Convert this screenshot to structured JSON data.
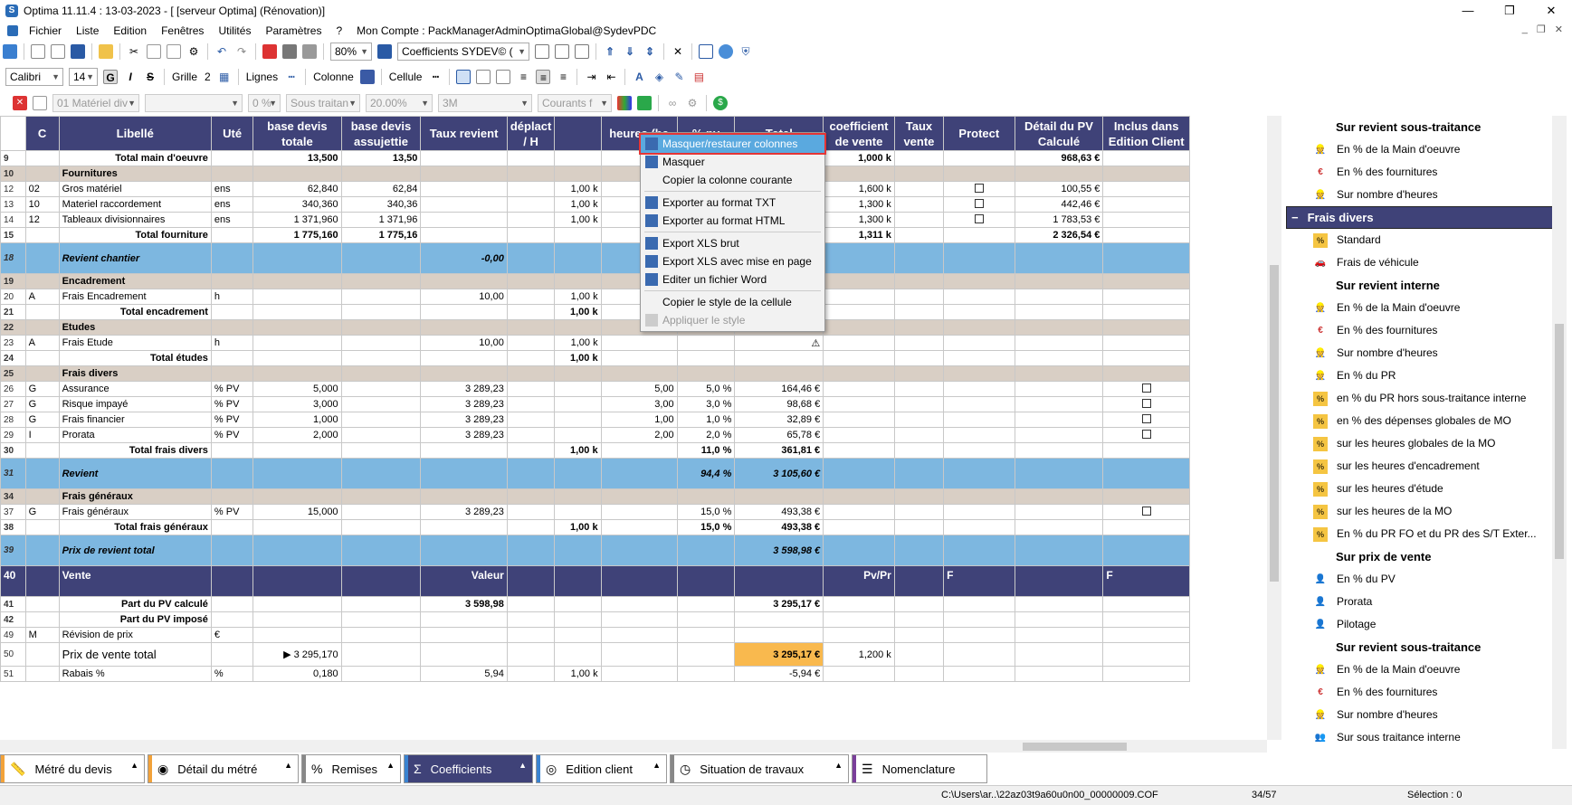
{
  "window": {
    "title": "Optima 11.11.4 : 13-03-2023 - [ [serveur Optima] (Rénovation)]",
    "min": "—",
    "max": "❐",
    "close": "✕"
  },
  "menu": [
    "Fichier",
    "Liste",
    "Edition",
    "Fenêtres",
    "Utilités",
    "Paramètres",
    "?",
    "Mon Compte : PackManagerAdminOptimaGlobal@SydevPDC"
  ],
  "toolbar1": {
    "zoom": "80%",
    "profile": "Coefficients  SYDEV© ("
  },
  "toolbar2": {
    "font": "Calibri",
    "size": "14",
    "bold": "G",
    "italic": "I",
    "strike": "S",
    "grille_label": "Grille",
    "grille_val": "2",
    "lignes_label": "Lignes",
    "colonne_label": "Colonne",
    "cellule_label": "Cellule"
  },
  "toolbar3": {
    "c1": "01  Matériel div",
    "c3": "0 %",
    "c4": "Sous traitan",
    "c5": "20.00%",
    "c6": "3M",
    "c7": "Courants f"
  },
  "grid": {
    "headers": [
      "",
      "C",
      "Libellé",
      "Uté",
      "base devis totale",
      "base devis assujettie",
      "Taux revient",
      "déplact / H",
      "",
      "heures (ba",
      "% pv",
      "Total",
      "coefficient de vente",
      "Taux vente",
      "Protect",
      "Détail du PV Calculé",
      "Inclus dans Edition Client"
    ],
    "rows": [
      {
        "kind": "tot",
        "cells": [
          "9",
          "",
          "Total main d'oeuvre",
          "",
          "13,500",
          "13,50",
          "",
          "",
          "",
          "",
          "",
          "€",
          "1,000 k",
          "",
          "",
          "968,63 €",
          ""
        ]
      },
      {
        "kind": "sect",
        "cells": [
          "10",
          "",
          "Fournitures",
          "",
          "",
          "",
          "",
          "",
          "",
          "",
          "",
          "",
          "",
          "",
          "",
          "",
          ""
        ]
      },
      {
        "kind": "row",
        "cells": [
          "12",
          "02",
          "Gros matériel",
          "ens",
          "62,840",
          "62,84",
          "",
          "",
          "1,00 k",
          "",
          "",
          "€",
          "1,600 k",
          "",
          "chk",
          "100,55 €",
          ""
        ]
      },
      {
        "kind": "row",
        "cells": [
          "13",
          "10",
          "Materiel raccordement",
          "ens",
          "340,360",
          "340,36",
          "",
          "",
          "1,00 k",
          "",
          "",
          "€",
          "1,300 k",
          "",
          "chk",
          "442,46 €",
          ""
        ]
      },
      {
        "kind": "row",
        "cells": [
          "14",
          "12",
          "Tableaux divisionnaires",
          "ens",
          "1 371,960",
          "1 371,96",
          "",
          "",
          "1,00 k",
          "",
          "",
          "€",
          "1,300 k",
          "",
          "chk",
          "1 783,53 €",
          ""
        ]
      },
      {
        "kind": "tot",
        "cells": [
          "15",
          "",
          "Total fourniture",
          "",
          "1 775,160",
          "1 775,16",
          "",
          "",
          "",
          "",
          "",
          "€",
          "1,311 k",
          "",
          "",
          "2 326,54 €",
          ""
        ]
      },
      {
        "kind": "blue",
        "cells": [
          "18",
          "",
          "Revient chantier",
          "",
          "",
          "",
          "-0,00",
          "",
          "",
          "",
          "",
          "€",
          "",
          "",
          "",
          "",
          ""
        ]
      },
      {
        "kind": "sect",
        "cells": [
          "19",
          "",
          "Encadrement",
          "",
          "",
          "",
          "",
          "",
          "",
          "",
          "",
          "",
          "",
          "",
          "",
          "",
          ""
        ]
      },
      {
        "kind": "row",
        "cells": [
          "20",
          "A",
          "Frais Encadrement",
          "h",
          "",
          "",
          "10,00",
          "",
          "1,00 k",
          "",
          "",
          "",
          "",
          "",
          "",
          "",
          ""
        ]
      },
      {
        "kind": "tot",
        "cells": [
          "21",
          "",
          "Total encadrement",
          "",
          "",
          "",
          "",
          "",
          "1,00 k",
          "",
          "",
          "",
          "",
          "",
          "",
          "",
          ""
        ]
      },
      {
        "kind": "sect",
        "cells": [
          "22",
          "",
          "Etudes",
          "",
          "",
          "",
          "",
          "",
          "",
          "",
          "",
          "",
          "",
          "",
          "",
          "",
          ""
        ]
      },
      {
        "kind": "row",
        "cells": [
          "23",
          "A",
          "Frais Etude",
          "h",
          "",
          "",
          "10,00",
          "",
          "1,00 k",
          "",
          "",
          "⚠",
          "",
          "",
          "",
          "",
          ""
        ]
      },
      {
        "kind": "tot",
        "cells": [
          "24",
          "",
          "Total études",
          "",
          "",
          "",
          "",
          "",
          "1,00 k",
          "",
          "",
          "",
          "",
          "",
          "",
          "",
          ""
        ]
      },
      {
        "kind": "sect",
        "cells": [
          "25",
          "",
          "Frais divers",
          "",
          "",
          "",
          "",
          "",
          "",
          "",
          "",
          "",
          "",
          "",
          "",
          "",
          ""
        ]
      },
      {
        "kind": "row",
        "cells": [
          "26",
          "G",
          "Assurance",
          "% PV",
          "5,000",
          "",
          "3 289,23",
          "",
          "",
          "5,00",
          "5,0 %",
          "164,46 €",
          "",
          "",
          "",
          "",
          "chk"
        ]
      },
      {
        "kind": "row",
        "cells": [
          "27",
          "G",
          "Risque impayé",
          "% PV",
          "3,000",
          "",
          "3 289,23",
          "",
          "",
          "3,00",
          "3,0 %",
          "98,68 €",
          "",
          "",
          "",
          "",
          "chk"
        ]
      },
      {
        "kind": "row",
        "cells": [
          "28",
          "G",
          "Frais financier",
          "% PV",
          "1,000",
          "",
          "3 289,23",
          "",
          "",
          "1,00",
          "1,0 %",
          "32,89 €",
          "",
          "",
          "",
          "",
          "chk"
        ]
      },
      {
        "kind": "row",
        "cells": [
          "29",
          "I",
          "Prorata",
          "% PV",
          "2,000",
          "",
          "3 289,23",
          "",
          "",
          "2,00",
          "2,0 %",
          "65,78 €",
          "",
          "",
          "",
          "",
          "chk"
        ]
      },
      {
        "kind": "tot",
        "cells": [
          "30",
          "",
          "Total frais divers",
          "",
          "",
          "",
          "",
          "",
          "1,00 k",
          "",
          "11,0 %",
          "361,81 €",
          "",
          "",
          "",
          "",
          ""
        ]
      },
      {
        "kind": "blue",
        "cells": [
          "31",
          "",
          "Revient",
          "",
          "",
          "",
          "",
          "",
          "",
          "",
          "94,4 %",
          "3 105,60 €",
          "",
          "",
          "",
          "",
          ""
        ]
      },
      {
        "kind": "sect",
        "cells": [
          "34",
          "",
          "Frais généraux",
          "",
          "",
          "",
          "",
          "",
          "",
          "",
          "",
          "",
          "",
          "",
          "",
          "",
          ""
        ]
      },
      {
        "kind": "row",
        "cells": [
          "37",
          "G",
          "Frais généraux",
          "% PV",
          "15,000",
          "",
          "3 289,23",
          "",
          "",
          "",
          "15,0 %",
          "493,38 €",
          "",
          "",
          "",
          "",
          "chk"
        ]
      },
      {
        "kind": "tot",
        "cells": [
          "38",
          "",
          "Total frais généraux",
          "",
          "",
          "",
          "",
          "",
          "1,00 k",
          "",
          "15,0 %",
          "493,38 €",
          "",
          "",
          "",
          "",
          ""
        ]
      },
      {
        "kind": "blue",
        "cells": [
          "39",
          "",
          "Prix de revient total",
          "",
          "",
          "",
          "",
          "",
          "",
          "",
          "",
          "3 598,98 €",
          "",
          "",
          "",
          "",
          ""
        ]
      },
      {
        "kind": "vente",
        "cells": [
          "40",
          "",
          "Vente",
          "",
          "",
          "",
          "Valeur",
          "",
          "",
          "",
          "",
          "",
          "Pv/Pr",
          "",
          "F",
          "",
          "F"
        ]
      },
      {
        "kind": "tot",
        "cells": [
          "41",
          "",
          "Part du PV calculé",
          "",
          "",
          "",
          "3 598,98",
          "",
          "",
          "",
          "",
          "3 295,17 €",
          "",
          "",
          "",
          "",
          ""
        ]
      },
      {
        "kind": "tot",
        "cells": [
          "42",
          "",
          "Part du PV imposé",
          "",
          "",
          "",
          "",
          "",
          "",
          "",
          "",
          "",
          "",
          "",
          "",
          "",
          ""
        ]
      },
      {
        "kind": "row",
        "cells": [
          "49",
          "M",
          "Révision de prix",
          "€",
          "",
          "",
          "",
          "",
          "",
          "",
          "",
          "",
          "",
          "",
          "",
          "",
          ""
        ]
      },
      {
        "kind": "tall",
        "cells": [
          "50",
          "",
          "Prix de vente total",
          "",
          "▶  3 295,170",
          "",
          "",
          "",
          "",
          "",
          "",
          "3 295,17 €",
          "1,200 k",
          "",
          "",
          "",
          ""
        ]
      },
      {
        "kind": "row",
        "cells": [
          "51",
          "",
          "Rabais %",
          "%",
          "0,180",
          "",
          "5,94",
          "",
          "1,00 k",
          "",
          "",
          "-5,94 €",
          "",
          "",
          "",
          "",
          ""
        ]
      }
    ]
  },
  "context_menu": [
    {
      "label": "Masquer/restaurer colonnes",
      "state": "highlighted",
      "icon": "columns-icon"
    },
    {
      "label": "Masquer",
      "state": "normal",
      "icon": "hide-icon"
    },
    {
      "label": "Copier la colonne courante",
      "state": "normal",
      "icon": ""
    },
    {
      "sep": true
    },
    {
      "label": "Exporter au format TXT",
      "state": "normal",
      "icon": "txt-icon"
    },
    {
      "label": "Exporter au format HTML",
      "state": "normal",
      "icon": "html-icon"
    },
    {
      "sep": true
    },
    {
      "label": "Export XLS brut",
      "state": "normal",
      "icon": "xls-icon"
    },
    {
      "label": "Export XLS avec mise en page",
      "state": "normal",
      "icon": "xls-layout-icon"
    },
    {
      "label": "Editer un fichier Word",
      "state": "normal",
      "icon": "word-icon"
    },
    {
      "sep": true
    },
    {
      "label": "Copier le style de la cellule",
      "state": "normal",
      "icon": ""
    },
    {
      "label": "Appliquer le style",
      "state": "disabled",
      "icon": "apply-style-icon"
    }
  ],
  "right_panel": [
    {
      "type": "hdr",
      "label": "Sur revient sous-traitance"
    },
    {
      "type": "item",
      "label": "En % de la Main d'oeuvre",
      "icon": "worker-icon"
    },
    {
      "type": "item",
      "label": "En % des fournitures",
      "icon": "euro-icon"
    },
    {
      "type": "item",
      "label": "Sur nombre d'heures",
      "icon": "worker-icon"
    },
    {
      "type": "group",
      "label": "Frais divers"
    },
    {
      "type": "item",
      "label": "Standard",
      "icon": "percent-icon"
    },
    {
      "type": "item",
      "label": "Frais de véhicule",
      "icon": "car-icon"
    },
    {
      "type": "hdr",
      "label": "Sur revient interne"
    },
    {
      "type": "item",
      "label": "En % de la Main d'oeuvre",
      "icon": "worker-icon"
    },
    {
      "type": "item",
      "label": "En % des fournitures",
      "icon": "euro-icon"
    },
    {
      "type": "item",
      "label": "Sur nombre d'heures",
      "icon": "worker-icon"
    },
    {
      "type": "item",
      "label": "En % du PR",
      "icon": "worker-icon"
    },
    {
      "type": "item",
      "label": "en % du PR hors sous-traitance interne",
      "icon": "percent-icon"
    },
    {
      "type": "item",
      "label": "en % des dépenses globales de MO",
      "icon": "percent-icon"
    },
    {
      "type": "item",
      "label": "sur les heures globales de la MO",
      "icon": "percent-icon"
    },
    {
      "type": "item",
      "label": "sur les heures d'encadrement",
      "icon": "percent-icon"
    },
    {
      "type": "item",
      "label": "sur les heures d'étude",
      "icon": "percent-icon"
    },
    {
      "type": "item",
      "label": "sur les heures de la MO",
      "icon": "percent-icon"
    },
    {
      "type": "item",
      "label": "En % du PR FO et du PR des S/T Exter...",
      "icon": "percent-icon"
    },
    {
      "type": "hdr",
      "label": "Sur prix de vente"
    },
    {
      "type": "item",
      "label": "En % du PV",
      "icon": "person-icon"
    },
    {
      "type": "item",
      "label": "Prorata",
      "icon": "person-icon"
    },
    {
      "type": "item",
      "label": "Pilotage",
      "icon": "person-icon"
    },
    {
      "type": "hdr",
      "label": "Sur revient sous-traitance"
    },
    {
      "type": "item",
      "label": "En % de la Main d'oeuvre",
      "icon": "worker-icon"
    },
    {
      "type": "item",
      "label": "En % des fournitures",
      "icon": "euro-icon"
    },
    {
      "type": "item",
      "label": "Sur nombre d'heures",
      "icon": "worker-icon"
    },
    {
      "type": "item",
      "label": "Sur sous traitance interne",
      "icon": "group-icon"
    }
  ],
  "tabs": [
    {
      "label": "Métré du devis",
      "icon": "ruler-icon",
      "active": false,
      "stripe": "#f2a23a",
      "width": 160
    },
    {
      "label": "Détail du métré",
      "icon": "eye-icon",
      "active": false,
      "stripe": "#f2a23a",
      "width": 167
    },
    {
      "label": "Remises",
      "icon": "percent-tab-icon",
      "active": false,
      "stripe": "#888888",
      "width": 110
    },
    {
      "label": "Coefficients",
      "icon": "sigma-icon",
      "active": true,
      "stripe": "#3a83d0",
      "width": 143
    },
    {
      "label": "Edition client",
      "icon": "person-tab-icon",
      "active": false,
      "stripe": "#3a83d0",
      "width": 145
    },
    {
      "label": "Situation de travaux",
      "icon": "clock-tab-icon",
      "active": false,
      "stripe": "#888888",
      "width": 198
    },
    {
      "label": "Nomenclature",
      "icon": "list-tab-icon",
      "active": false,
      "stripe": "#7a3f9a",
      "width": 150
    }
  ],
  "status": {
    "path": "C:\\Users\\ar..\\22az03t9a60u0n00_00000009.COF",
    "pos": "34/57",
    "selection": "Sélection : 0"
  },
  "colors": {
    "header": "#3f4278",
    "section": "#d9cfc5",
    "blue_row": "#7db7e0",
    "highlight": "#5aa9df",
    "orange": "#f9b94e"
  }
}
